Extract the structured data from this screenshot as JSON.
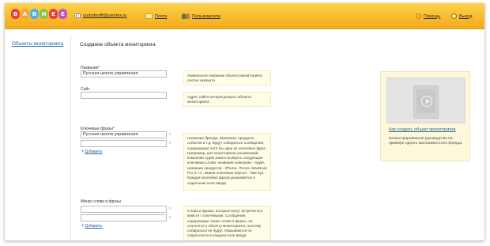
{
  "header": {
    "logo_letters": [
      "B",
      "A",
      "B",
      "H",
      "E",
      "E"
    ],
    "email": "yurbotnoffl@yandex.ru",
    "mail_label": "Почта",
    "users_label": "Пользователи",
    "help_label": "Помощь",
    "exit_label": "Выход"
  },
  "sidebar": {
    "link": "Объекты мониторинга"
  },
  "page": {
    "title": "Создание объекта мониторинга"
  },
  "form": {
    "name_label": "Название",
    "name_value": "Русская школа управления",
    "name_hint": "Уникальное название объекта мониторинга охотно аккаунта",
    "site_label": "Сайт",
    "site_value": "",
    "site_hint": "Адрес сайта интересующего объекта мониторинга",
    "keywords_label": "Ключевые фразы",
    "keywords_values": [
      "Русская школа управления",
      ""
    ],
    "keywords_add": "Добавить",
    "keywords_hint": "Название бренда, компании, продукта, события и т.д. Будут собираться сообщения, содержащие хотя бы одну из ключевых фраз. Например, для мониторинга упоминаний компании Apple можно выбрать следующие ключевые слова: название компании - Apple, названия продуктов - iPhone, iTunes, MacBook Pro и т.п., имена ключевых персон - Тим Кук. Каждая ключевая фраза указывается в отдельном поле ввода",
    "minus_label": "Минус-слова и фразы",
    "minus_values": [
      "",
      ""
    ],
    "minus_add": "Добавить",
    "minus_hint": "Слова и фразы, которые могут встречаться вместе с ключевыми. Сообщения, содержащие такие слова и фразы, не относятся к объекту мониторинга, поэтому собираться не будут. Указываются по отдельности в каждом поле ввода",
    "required_mark": "*"
  },
  "panel": {
    "link": "Как создать объект мониторинга",
    "description": "Иллюстрированное руководство на примере одного малоизвестного бренда."
  },
  "colors": {
    "header_top": "#ffd34d",
    "header_bottom": "#f3a91b",
    "link": "#2a6496",
    "hint_bg": "#fffde6"
  }
}
